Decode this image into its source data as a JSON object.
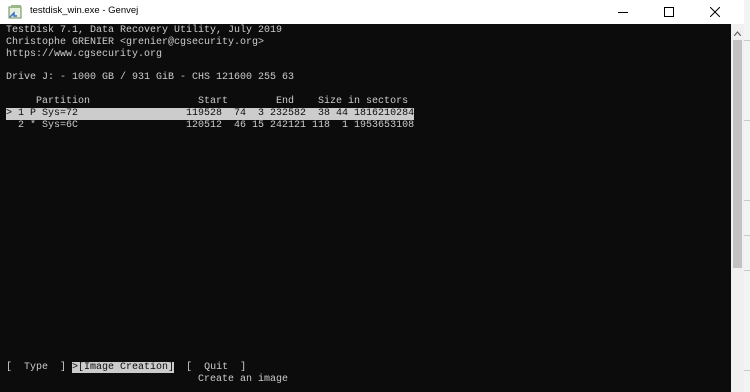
{
  "window": {
    "title": "testdisk_win.exe - Genvej",
    "icon": "shortcut-app-icon",
    "buttons": [
      "minimize-icon",
      "maximize-icon",
      "close-icon"
    ]
  },
  "console": {
    "header": [
      "TestDisk 7.1, Data Recovery Utility, July 2019",
      "Christophe GRENIER <grenier@cgsecurity.org>",
      "https://www.cgsecurity.org"
    ],
    "drive": "Drive J: - 1000 GB / 931 GiB - CHS 121600 255 63",
    "table_header": "     Partition                  Start        End    Size in sectors",
    "partitions": [
      {
        "text": "> 1 P Sys=72                  119528  74  3 232582  38 44 1816210284",
        "selected": true
      },
      {
        "text": "  2 * Sys=6C                  120512  46 15 242121 118  1 1953653108",
        "selected": false
      }
    ],
    "menu": {
      "type": "[  Type  ]",
      "image_creation": ">[Image Creation]",
      "quit": "[  Quit  ]",
      "hint": "Create an image"
    }
  },
  "colors": {
    "console_bg": "#0c0c0c",
    "console_fg": "#cccccc",
    "selection_bg": "#cccccc"
  }
}
